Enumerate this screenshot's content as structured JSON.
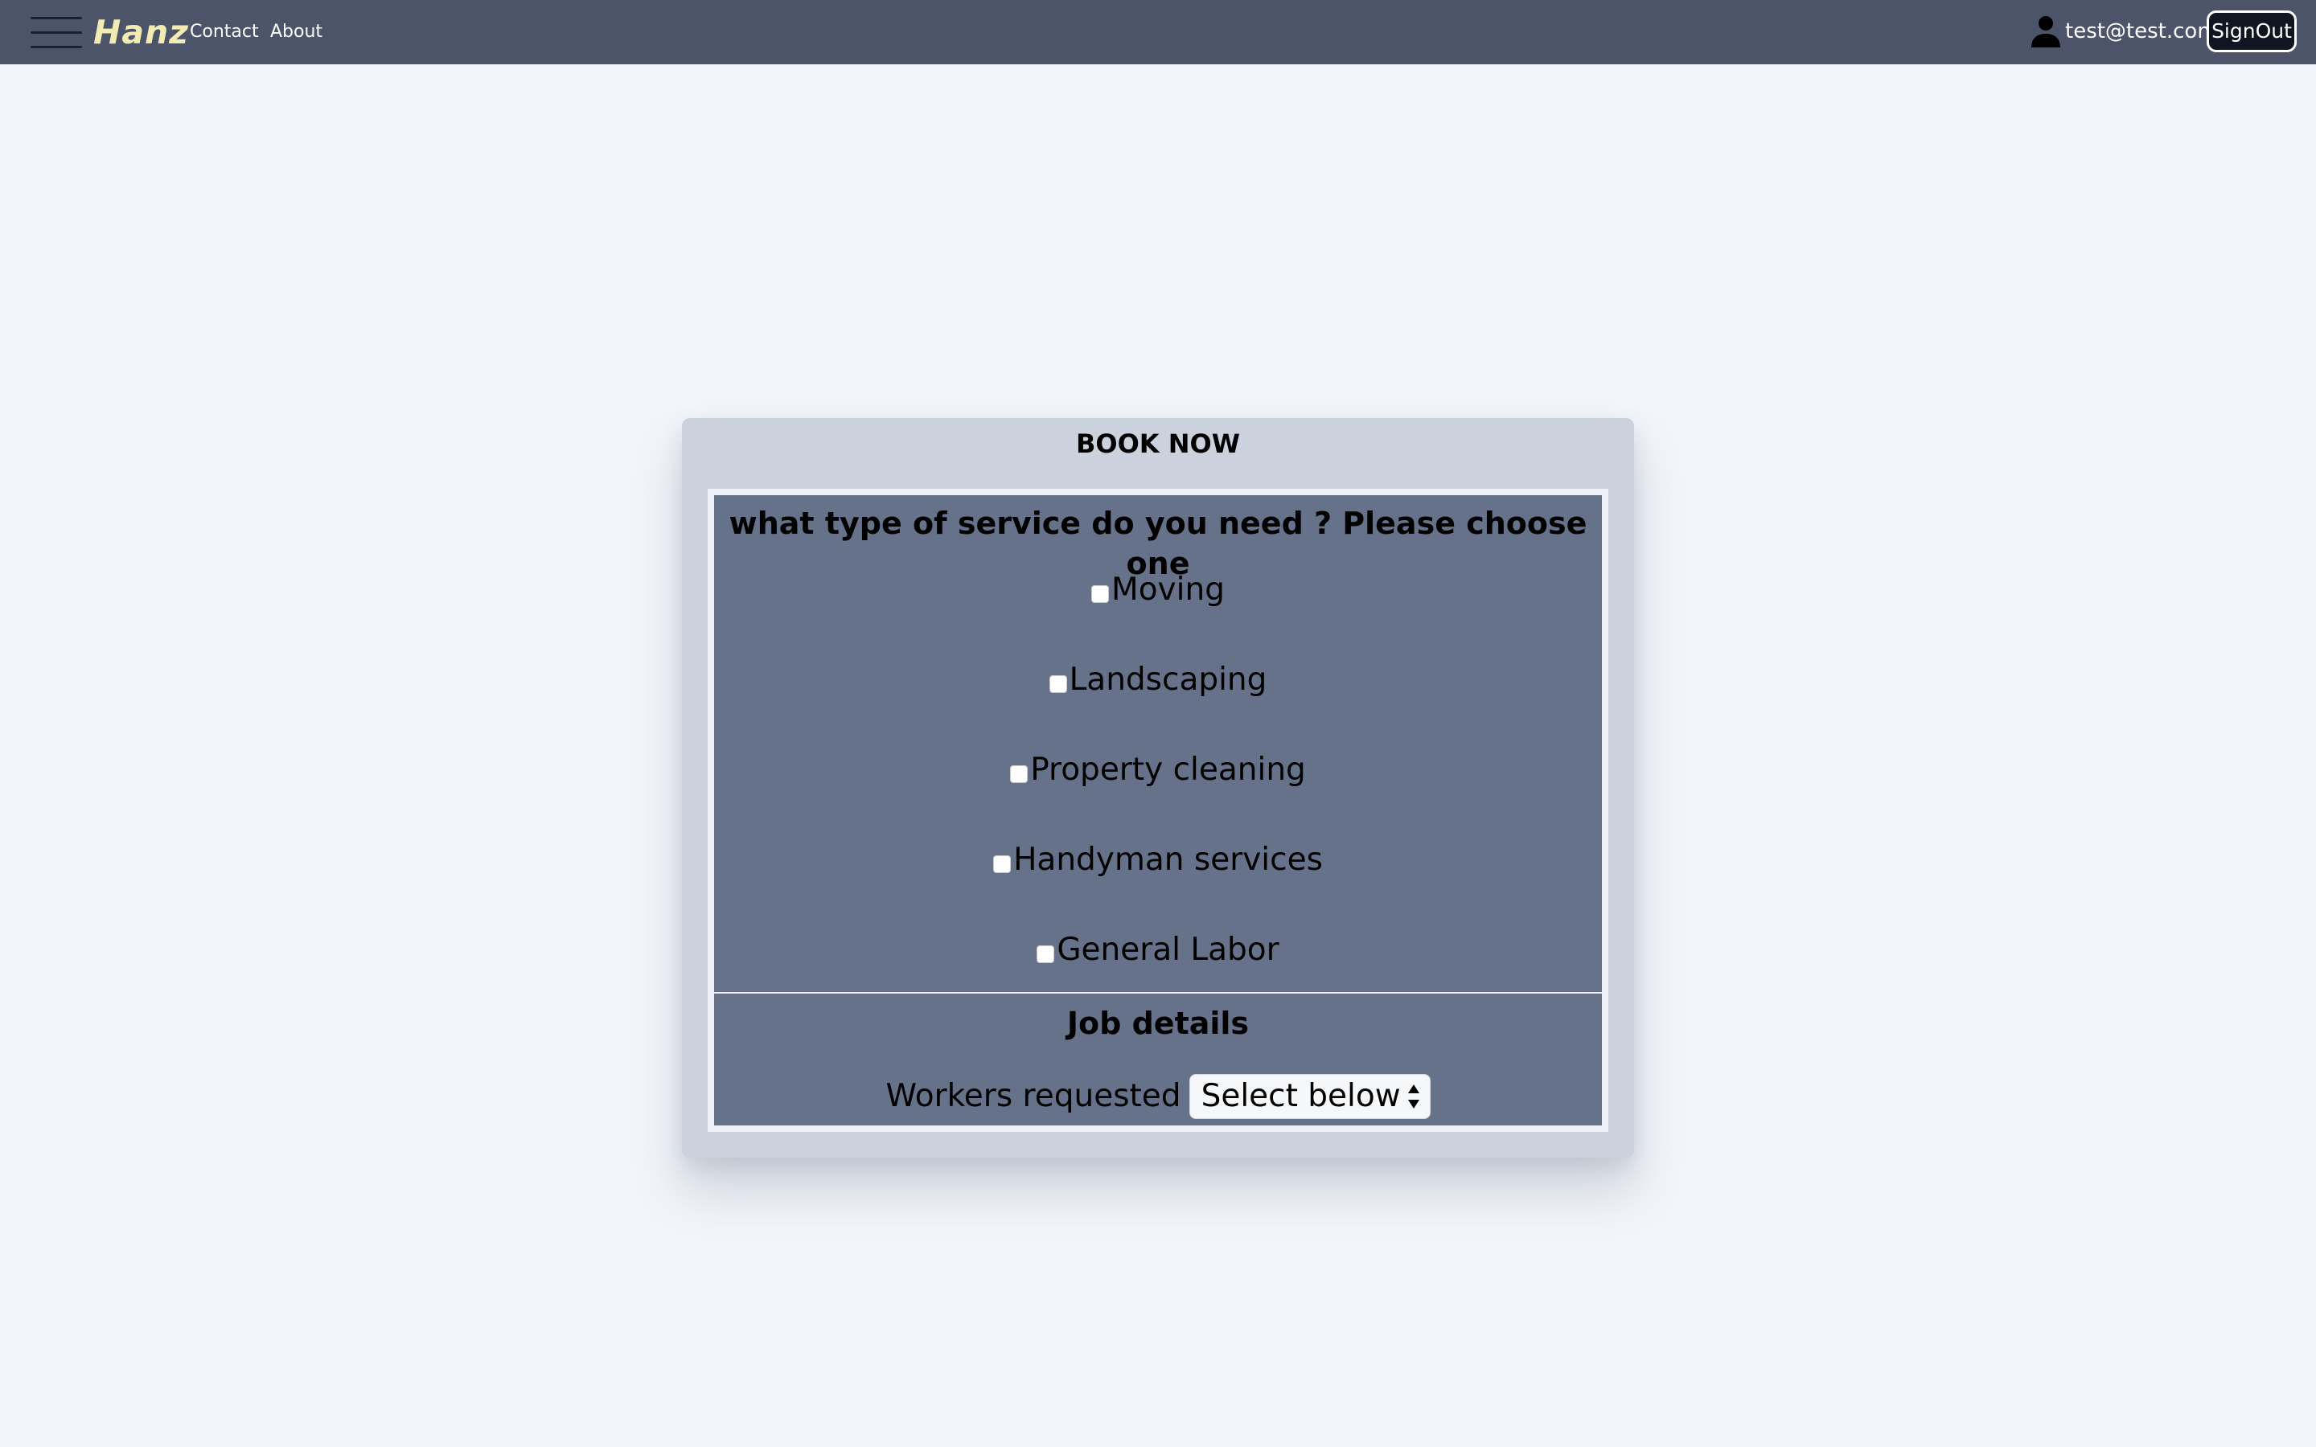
{
  "navbar": {
    "brand": "Hanz",
    "links": [
      "Contact",
      "About"
    ],
    "user_email": "test@test.com",
    "signout_label": "SignOut",
    "icons": {
      "menu": "hamburger-menu-icon",
      "user": "user-icon"
    }
  },
  "booking": {
    "title": "BOOK NOW",
    "services_heading": "what type of service do you need ? Please choose one",
    "services": [
      {
        "label": "Moving",
        "checked": false
      },
      {
        "label": "Landscaping",
        "checked": false
      },
      {
        "label": "Property cleaning",
        "checked": false
      },
      {
        "label": "Handyman services",
        "checked": false
      },
      {
        "label": "General Labor",
        "checked": false
      }
    ],
    "job_heading": "Job details",
    "workers_label": "Workers requested",
    "workers_selected": "Select below"
  },
  "colors": {
    "navbar_bg": "#4b5468",
    "page_bg": "#f2f5f9",
    "card_bg": "#cbd2dd",
    "form_bg": "#667289",
    "brand": "#f3ebb4"
  }
}
